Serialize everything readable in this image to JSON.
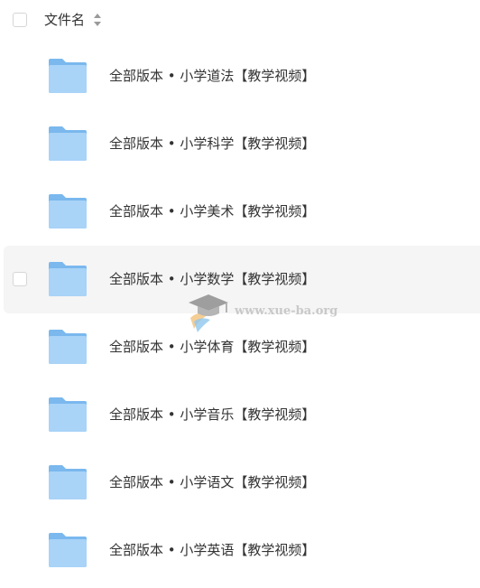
{
  "header": {
    "title": "文件名"
  },
  "icons": {
    "folder": "folder-icon",
    "sort": "sort-icon",
    "checkbox": "checkbox"
  },
  "colors": {
    "folder_light": "#a9d3f7",
    "folder_dark": "#7ab8ee",
    "hover_row": "#f5f5f5",
    "text": "#333333"
  },
  "files": [
    {
      "name": "全部版本 • 小学道法【教学视频】"
    },
    {
      "name": "全部版本 • 小学科学【教学视频】"
    },
    {
      "name": "全部版本 • 小学美术【教学视频】"
    },
    {
      "name": "全部版本 • 小学数学【教学视频】"
    },
    {
      "name": "全部版本 • 小学体育【教学视频】"
    },
    {
      "name": "全部版本 • 小学音乐【教学视频】"
    },
    {
      "name": "全部版本 • 小学语文【教学视频】"
    },
    {
      "name": "全部版本 • 小学英语【教学视频】"
    }
  ],
  "watermark": {
    "text": "www.xue-ba.org"
  }
}
